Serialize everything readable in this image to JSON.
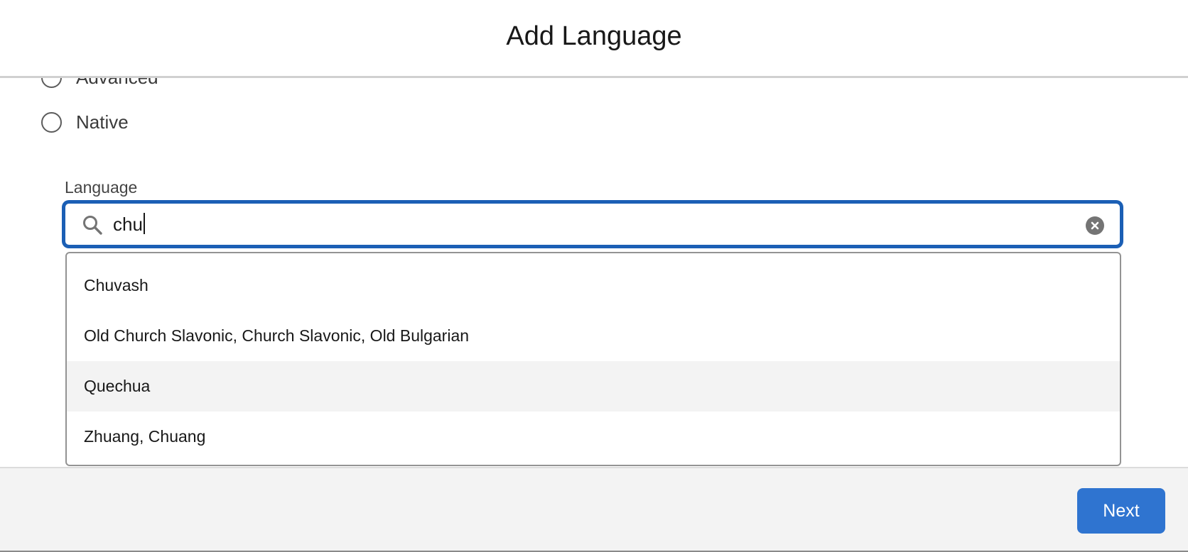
{
  "modal": {
    "title": "Add Language"
  },
  "proficiency": {
    "options": [
      {
        "label": "Advanced",
        "selected": false
      },
      {
        "label": "Native",
        "selected": false
      }
    ]
  },
  "language_field": {
    "label": "Language",
    "value": "chu",
    "icon": "search-icon",
    "clear_icon": "clear-icon"
  },
  "dropdown": {
    "options": [
      {
        "label": "Chuvash",
        "highlighted": false
      },
      {
        "label": "Old Church Slavonic, Church Slavonic, Old Bulgarian",
        "highlighted": false
      },
      {
        "label": "Quechua",
        "highlighted": true
      },
      {
        "label": "Zhuang, Chuang",
        "highlighted": false
      }
    ]
  },
  "footer": {
    "next_label": "Next"
  },
  "colors": {
    "accent": "#2f74d0",
    "focus_border": "#1b5fb5",
    "highlight": "#f3f3f3"
  }
}
